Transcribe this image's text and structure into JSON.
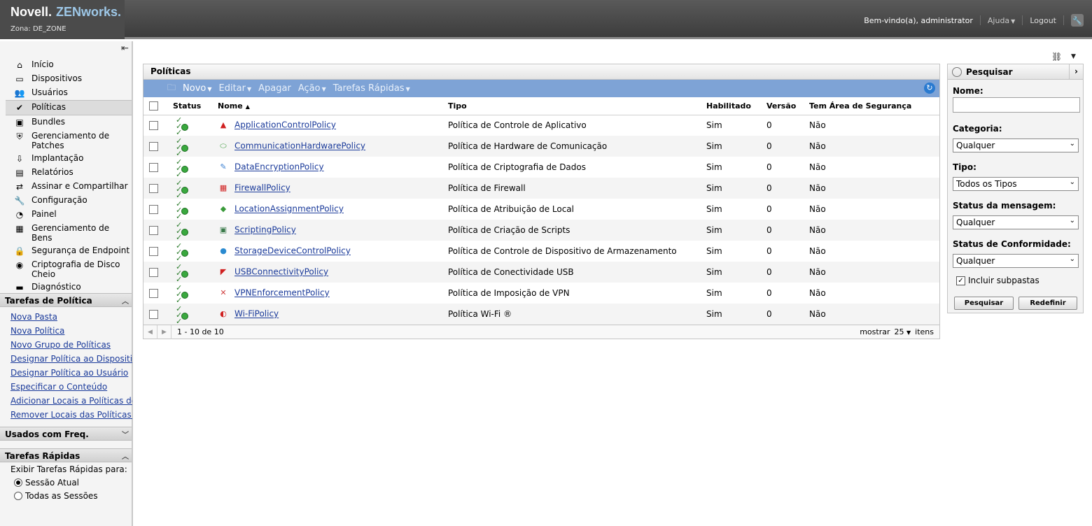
{
  "header": {
    "brand": "Novell.",
    "product": "ZENworks.",
    "zone": "Zona: DE_ZONE",
    "welcome": "Bem-vindo(a), administrator",
    "help": "Ajuda",
    "logout": "Logout"
  },
  "nav": {
    "items": [
      {
        "label": "Início",
        "icon": "home-icon"
      },
      {
        "label": "Dispositivos",
        "icon": "devices-icon"
      },
      {
        "label": "Usuários",
        "icon": "users-icon"
      },
      {
        "label": "Políticas",
        "icon": "policies-icon"
      },
      {
        "label": "Bundles",
        "icon": "bundles-icon"
      },
      {
        "label": "Gerenciamento de Patches",
        "icon": "patch-icon"
      },
      {
        "label": "Implantação",
        "icon": "deployment-icon"
      },
      {
        "label": "Relatórios",
        "icon": "reports-icon"
      },
      {
        "label": "Assinar e Compartilhar",
        "icon": "subscribe-icon"
      },
      {
        "label": "Configuração",
        "icon": "wrench-icon"
      },
      {
        "label": "Painel",
        "icon": "dashboard-icon"
      },
      {
        "label": "Gerenciamento de Bens",
        "icon": "asset-icon"
      },
      {
        "label": "Segurança de Endpoint",
        "icon": "lock-icon"
      },
      {
        "label": "Criptografia de Disco Cheio",
        "icon": "disk-icon"
      },
      {
        "label": "Diagnóstico",
        "icon": "diagnostic-icon"
      }
    ],
    "active": "Políticas"
  },
  "tasks": {
    "title": "Tarefas de Política",
    "links": [
      "Nova Pasta",
      "Nova Política",
      "Novo Grupo de Políticas",
      "Designar Política ao Dispositivo",
      "Designar Política ao Usuário",
      "Especificar o Conteúdo",
      "Adicionar Locais a Políticas de",
      "Remover Locais das Políticas de"
    ]
  },
  "freq": {
    "title": "Usados com Freq."
  },
  "quick": {
    "title": "Tarefas Rápidas",
    "prompt": "Exibir Tarefas Rápidas para:",
    "opt1": "Sessão Atual",
    "opt2": "Todas as Sessões"
  },
  "panel": {
    "title": "Políticas",
    "toolbar": {
      "new": "Novo",
      "edit": "Editar",
      "delete": "Apagar",
      "action": "Ação",
      "quick": "Tarefas Rápidas"
    },
    "columns": [
      "Status",
      "Nome",
      "Tipo",
      "Habilitado",
      "Versão",
      "Tem Área de Segurança"
    ],
    "rows": [
      {
        "name": "ApplicationControlPolicy",
        "type": "Política de Controle de Aplicativo",
        "enabled": "Sim",
        "version": "0",
        "sandbox": "Não",
        "icon": "app-control-icon",
        "color": "#d02020"
      },
      {
        "name": "CommunicationHardwarePolicy",
        "type": "Política de Hardware de Comunicação",
        "enabled": "Sim",
        "version": "0",
        "sandbox": "Não",
        "icon": "comm-hardware-icon",
        "color": "#3a9a3a"
      },
      {
        "name": "DataEncryptionPolicy",
        "type": "Política de Criptografia de Dados",
        "enabled": "Sim",
        "version": "0",
        "sandbox": "Não",
        "icon": "encryption-icon",
        "color": "#3a7fd0"
      },
      {
        "name": "FirewallPolicy",
        "type": "Política de Firewall",
        "enabled": "Sim",
        "version": "0",
        "sandbox": "Não",
        "icon": "firewall-icon",
        "color": "#d02020"
      },
      {
        "name": "LocationAssignmentPolicy",
        "type": "Política de Atribuição de Local",
        "enabled": "Sim",
        "version": "0",
        "sandbox": "Não",
        "icon": "location-icon",
        "color": "#3a9a3a"
      },
      {
        "name": "ScriptingPolicy",
        "type": "Política de Criação de Scripts",
        "enabled": "Sim",
        "version": "0",
        "sandbox": "Não",
        "icon": "scripting-icon",
        "color": "#3a7a4a"
      },
      {
        "name": "StorageDeviceControlPolicy",
        "type": "Política de Controle de Dispositivo de Armazenamento",
        "enabled": "Sim",
        "version": "0",
        "sandbox": "Não",
        "icon": "storage-icon",
        "color": "#2a8ad0"
      },
      {
        "name": "USBConnectivityPolicy",
        "type": "Política de Conectividade USB",
        "enabled": "Sim",
        "version": "0",
        "sandbox": "Não",
        "icon": "usb-icon",
        "color": "#d02020"
      },
      {
        "name": "VPNEnforcementPolicy",
        "type": "Política de Imposição de VPN",
        "enabled": "Sim",
        "version": "0",
        "sandbox": "Não",
        "icon": "vpn-icon",
        "color": "#d04040"
      },
      {
        "name": "Wi-FiPolicy",
        "type": "Política Wi-Fi ®",
        "enabled": "Sim",
        "version": "0",
        "sandbox": "Não",
        "icon": "wifi-icon",
        "color": "#d02020"
      }
    ],
    "pager": {
      "range": "1 - 10 de 10",
      "show": "mostrar",
      "per_page": "25",
      "items": "itens"
    }
  },
  "search": {
    "title": "Pesquisar",
    "name_label": "Nome:",
    "category_label": "Categoria:",
    "category_value": "Qualquer",
    "type_label": "Tipo:",
    "type_value": "Todos os Tipos",
    "msg_label": "Status da mensagem:",
    "msg_value": "Qualquer",
    "compliance_label": "Status de Conformidade:",
    "compliance_value": "Qualquer",
    "subfolders": "Incluir subpastas",
    "search_btn": "Pesquisar",
    "reset_btn": "Redefinir"
  },
  "colors": {
    "toolbar": "#7ea3d6",
    "link": "#1a3a9a",
    "header": "#4b4b4b"
  }
}
